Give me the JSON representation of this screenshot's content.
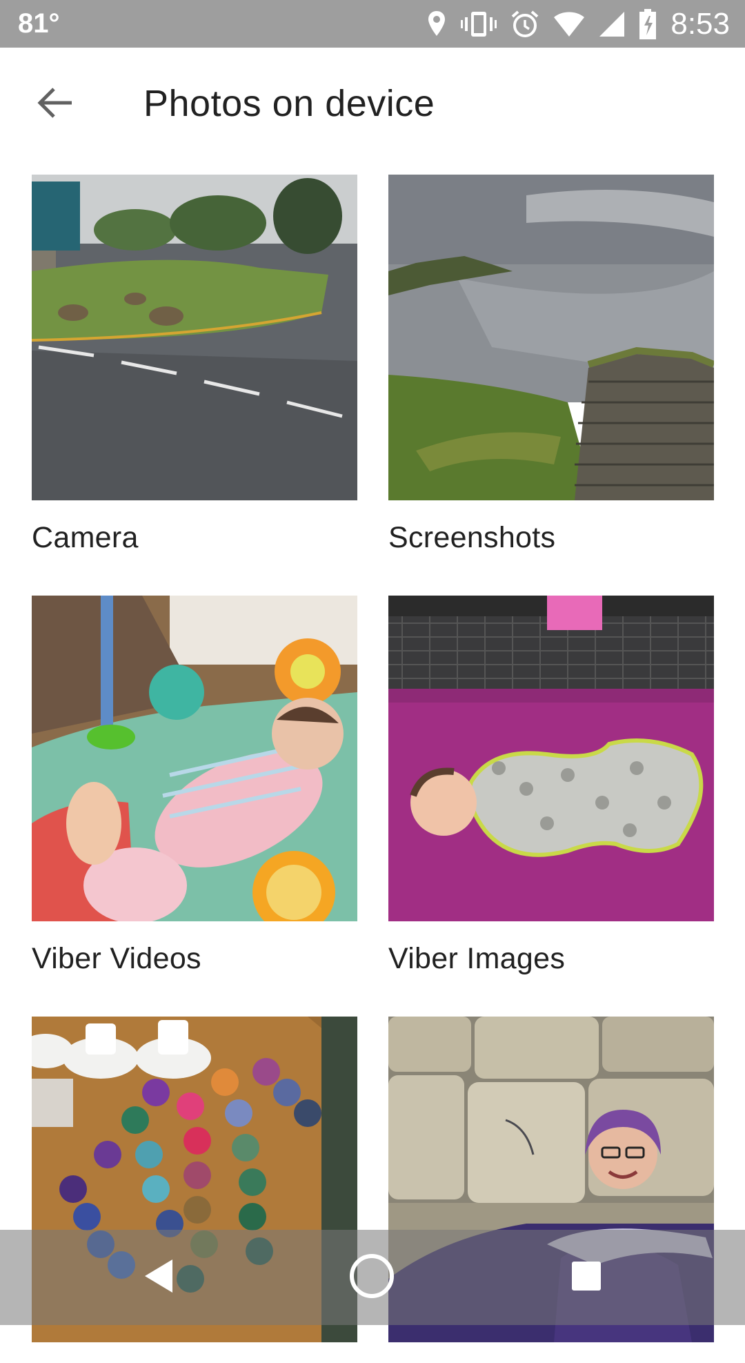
{
  "status": {
    "temperature": "81°",
    "time": "8:53",
    "icons": [
      "location-icon",
      "vibrate-icon",
      "alarm-icon",
      "wifi-icon",
      "signal-icon",
      "battery-charging-icon"
    ]
  },
  "header": {
    "title": "Photos on device",
    "back_icon": "arrow-back-icon"
  },
  "albums": [
    {
      "label": "Camera"
    },
    {
      "label": "Screenshots"
    },
    {
      "label": "Viber Videos"
    },
    {
      "label": "Viber Images"
    },
    {
      "label": ""
    },
    {
      "label": ""
    }
  ],
  "nav": {
    "icons": [
      "back-triangle-icon",
      "home-circle-icon",
      "recents-square-icon"
    ]
  },
  "colors": {
    "status_bar": "#9e9e9e",
    "text": "#212121",
    "icon_gray": "#616161"
  }
}
